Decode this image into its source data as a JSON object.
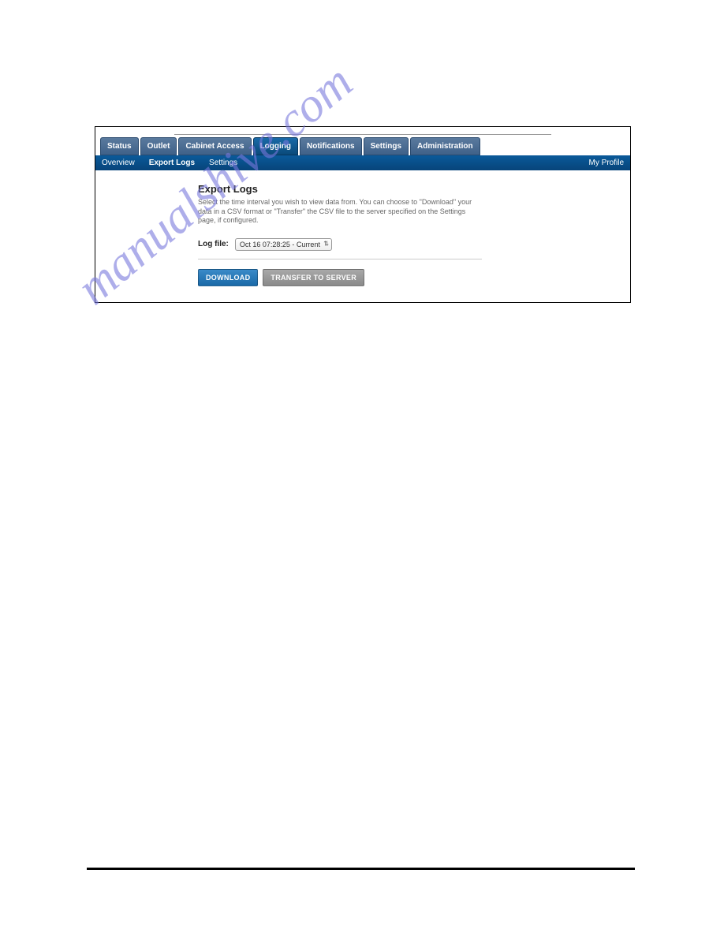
{
  "tabs": {
    "main": [
      {
        "label": "Status",
        "active": false
      },
      {
        "label": "Outlet",
        "active": false
      },
      {
        "label": "Cabinet Access",
        "active": false
      },
      {
        "label": "Logging",
        "active": true
      },
      {
        "label": "Notifications",
        "active": false
      },
      {
        "label": "Settings",
        "active": false
      },
      {
        "label": "Administration",
        "active": false
      }
    ],
    "sub": [
      {
        "label": "Overview",
        "active": false
      },
      {
        "label": "Export Logs",
        "active": true
      },
      {
        "label": "Settings",
        "active": false
      }
    ],
    "profile_link": "My Profile"
  },
  "page": {
    "title": "Export Logs",
    "description": "Select the time interval you wish to view data from. You can choose to \"Download\" your data in a CSV format or \"Transfer\" the CSV file to the server specified on the Settings page, if configured."
  },
  "form": {
    "log_file_label": "Log file:",
    "log_file_selected": "Oct 16 07:28:25 - Current"
  },
  "buttons": {
    "download": "DOWNLOAD",
    "transfer": "TRANSFER TO SERVER"
  },
  "watermark": "manualshive.com"
}
